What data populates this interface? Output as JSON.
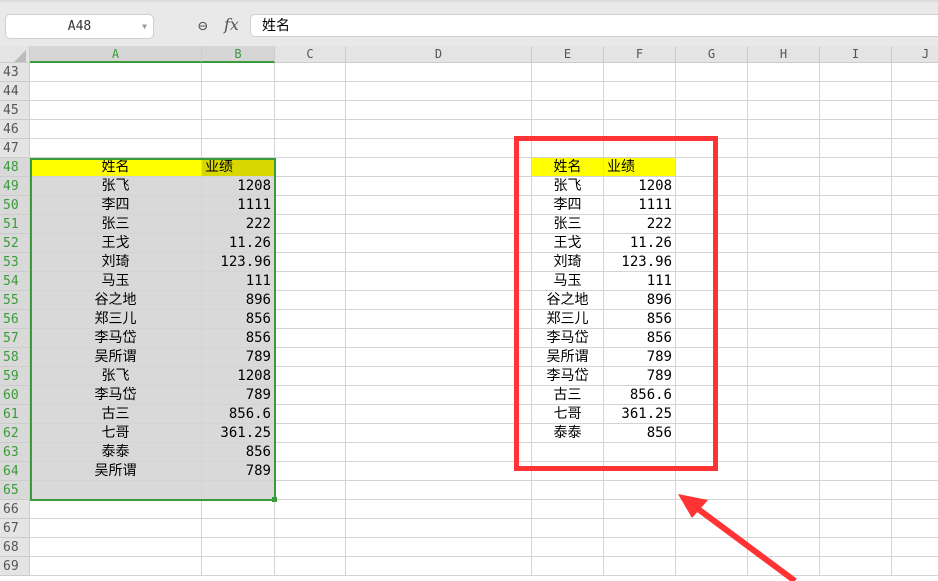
{
  "name_box": "A48",
  "formula_value": "姓名",
  "columns": [
    "A",
    "B",
    "C",
    "D",
    "E",
    "F",
    "G",
    "H",
    "I",
    "J"
  ],
  "selected_columns": [
    "A",
    "B"
  ],
  "first_row": 43,
  "row_count": 27,
  "selected_rows": [
    48,
    65
  ],
  "left_table": {
    "headers": [
      "姓名",
      "业绩"
    ],
    "rows": [
      [
        "张飞",
        "1208"
      ],
      [
        "李四",
        "1111"
      ],
      [
        "张三",
        "222"
      ],
      [
        "王戈",
        "11.26"
      ],
      [
        "刘琦",
        "123.96"
      ],
      [
        "马玉",
        "111"
      ],
      [
        "谷之地",
        "896"
      ],
      [
        "郑三儿",
        "856"
      ],
      [
        "李马岱",
        "856"
      ],
      [
        "吴所谓",
        "789"
      ],
      [
        "张飞",
        "1208"
      ],
      [
        "李马岱",
        "789"
      ],
      [
        "古三",
        "856.6"
      ],
      [
        "七哥",
        "361.25"
      ],
      [
        "泰泰",
        "856"
      ],
      [
        "吴所谓",
        "789"
      ]
    ]
  },
  "right_table": {
    "headers": [
      "姓名",
      "业绩"
    ],
    "rows": [
      [
        "张飞",
        "1208"
      ],
      [
        "李四",
        "1111"
      ],
      [
        "张三",
        "222"
      ],
      [
        "王戈",
        "11.26"
      ],
      [
        "刘琦",
        "123.96"
      ],
      [
        "马玉",
        "111"
      ],
      [
        "谷之地",
        "896"
      ],
      [
        "郑三儿",
        "856"
      ],
      [
        "李马岱",
        "856"
      ],
      [
        "吴所谓",
        "789"
      ],
      [
        "李马岱",
        "789"
      ],
      [
        "古三",
        "856.6"
      ],
      [
        "七哥",
        "361.25"
      ],
      [
        "泰泰",
        "856"
      ]
    ]
  },
  "colors": {
    "highlight": "#ffff00",
    "selection": "#3a9b3a",
    "annotation": "#ff3333"
  }
}
